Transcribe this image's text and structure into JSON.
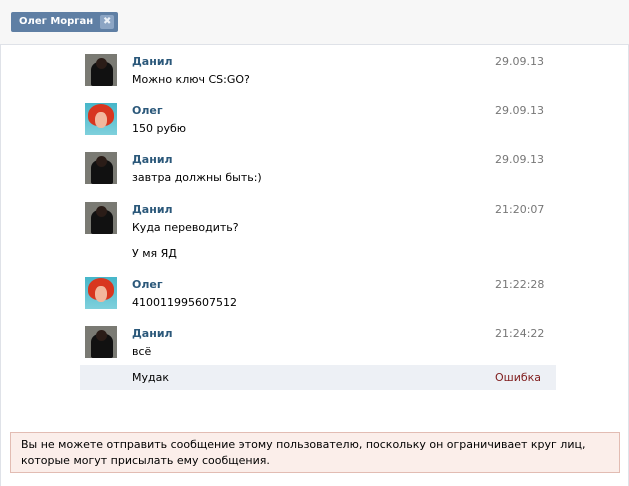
{
  "tab": {
    "label": "Олег Морган",
    "close_glyph": "✖"
  },
  "messages": [
    {
      "author": "Данил",
      "avatar": "danil-avatar",
      "time": "29.09.13",
      "lines": [
        "Можно ключ CS:GO?"
      ]
    },
    {
      "author": "Олег",
      "avatar": "oleg-avatar",
      "time": "29.09.13",
      "lines": [
        "150 рубю"
      ]
    },
    {
      "author": "Данил",
      "avatar": "danil-avatar",
      "time": "29.09.13",
      "lines": [
        "завтра должны быть:)"
      ]
    },
    {
      "author": "Данил",
      "avatar": "danil-avatar",
      "time": "21:20:07",
      "lines": [
        "Куда переводить?",
        "У мя ЯД"
      ]
    },
    {
      "author": "Олег",
      "avatar": "oleg-avatar",
      "time": "21:22:28",
      "lines": [
        "410011995607512"
      ]
    },
    {
      "author": "Данил",
      "avatar": "danil-avatar",
      "time": "21:24:22",
      "lines": [
        "всё"
      ]
    }
  ],
  "failed_message": {
    "text": "Мудак",
    "status": "Ошибка",
    "status_color": "#7f1c1c"
  },
  "notice": {
    "text": "Вы не можете отправить сообщение этому пользователю, поскольку он ограничивает круг лиц, которые могут присылать ему сообщения."
  },
  "colors": {
    "author": "#2b587a",
    "tab_bg": "#5f7fa4",
    "notice_bg": "#fbeeea",
    "notice_border": "#e2bcb3"
  }
}
